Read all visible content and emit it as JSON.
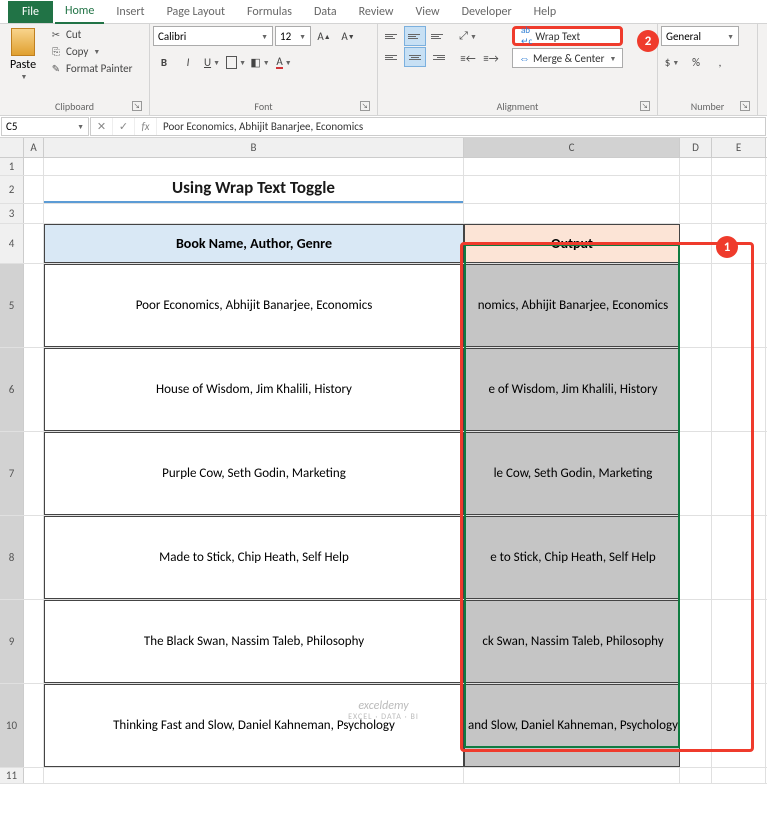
{
  "tabs": {
    "file": "File",
    "home": "Home",
    "insert": "Insert",
    "pagelayout": "Page Layout",
    "formulas": "Formulas",
    "data": "Data",
    "review": "Review",
    "view": "View",
    "developer": "Developer",
    "help": "Help"
  },
  "clipboard": {
    "paste": "Paste",
    "cut": "Cut",
    "copy": "Copy",
    "fmt": "Format Painter",
    "label": "Clipboard"
  },
  "font": {
    "name": "Calibri",
    "size": "12",
    "label": "Font"
  },
  "alignment": {
    "wrap": "Wrap Text",
    "merge": "Merge & Center",
    "label": "Alignment"
  },
  "number": {
    "format": "General",
    "label": "Number"
  },
  "callouts": {
    "one": "1",
    "two": "2"
  },
  "namebox": "C5",
  "fx": "fx",
  "formula": "Poor Economics, Abhijit Banarjee, Economics",
  "cols": {
    "A": "A",
    "B": "B",
    "C": "C",
    "D": "D",
    "E": "E"
  },
  "rows": {
    "r1": "1",
    "r2": "2",
    "r3": "3",
    "r4": "4",
    "r5": "5",
    "r6": "6",
    "r7": "7",
    "r8": "8",
    "r9": "9",
    "r10": "10",
    "r11": "11"
  },
  "title": "Using Wrap Text Toggle",
  "headers": {
    "b": "Book Name, Author, Genre",
    "c": "Output"
  },
  "data": [
    {
      "b": "Poor Economics, Abhijit Banarjee, Economics",
      "c": "Poor Economics, Abhijit Banarjee, Economics",
      "cshow": "nomics, Abhijit Banarjee, Economics"
    },
    {
      "b": "House of Wisdom, Jim Khalili, History",
      "c": "House of Wisdom, Jim Khalili, History",
      "cshow": "e of Wisdom, Jim Khalili, History"
    },
    {
      "b": "Purple Cow, Seth Godin, Marketing",
      "c": "Purple Cow, Seth Godin, Marketing",
      "cshow": "le Cow, Seth Godin, Marketing"
    },
    {
      "b": "Made to Stick, Chip Heath, Self Help",
      "c": "Made to Stick, Chip Heath, Self Help",
      "cshow": "e to Stick, Chip Heath, Self Help"
    },
    {
      "b": "The Black Swan, Nassim Taleb, Philosophy",
      "c": "The Black Swan, Nassim Taleb, Philosophy",
      "cshow": "ck Swan, Nassim Taleb, Philosophy"
    },
    {
      "b": "Thinking Fast and Slow, Daniel Kahneman, Psychology",
      "c": "Thinking Fast and Slow, Daniel Kahneman, Psychology",
      "cshow": "and Slow, Daniel Kahneman, Psychology"
    }
  ],
  "watermark": "exceldemy",
  "watermark_sub": "EXCEL · DATA · BI"
}
